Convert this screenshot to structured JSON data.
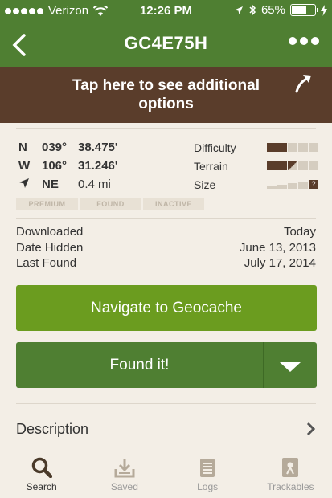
{
  "status": {
    "carrier": "Verizon",
    "time": "12:26 PM",
    "battery": "65%",
    "battery_level": 0.65
  },
  "nav": {
    "title": "GC4E75H"
  },
  "banner": {
    "text": "Tap here to see additional options"
  },
  "coords": [
    {
      "dir": "N",
      "deg": "039°",
      "min": "38.475'"
    },
    {
      "dir": "W",
      "deg": "106°",
      "min": "31.246'"
    }
  ],
  "heading": {
    "dir": "NE",
    "distance": "0.4 mi"
  },
  "ratings": {
    "difficulty_label": "Difficulty",
    "difficulty": 2,
    "terrain_label": "Terrain",
    "terrain": 2.5,
    "size_label": "Size",
    "size": "?"
  },
  "tags": [
    "PREMIUM",
    "FOUND",
    "INACTIVE"
  ],
  "dates": [
    {
      "label": "Downloaded",
      "value": "Today"
    },
    {
      "label": "Date Hidden",
      "value": "June 13, 2013"
    },
    {
      "label": "Last Found",
      "value": "July 17, 2014"
    }
  ],
  "buttons": {
    "navigate": "Navigate to Geocache",
    "found": "Found it!"
  },
  "description": {
    "label": "Description"
  },
  "tabs": [
    "Search",
    "Saved",
    "Logs",
    "Trackables"
  ]
}
